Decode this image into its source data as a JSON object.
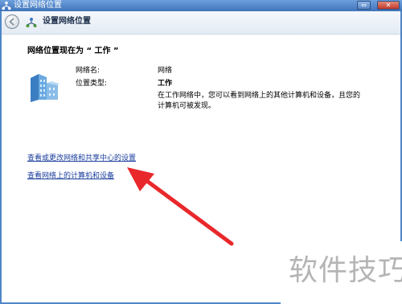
{
  "window": {
    "title": "设置网络位置",
    "icon": "network-icon",
    "controls": {
      "restore": "⇔",
      "close": "✕"
    }
  },
  "nav": {
    "back_icon": "back-arrow-icon",
    "icon": "network-icon",
    "title": "设置网络位置"
  },
  "main": {
    "heading": "网络位置现在为 “ 工作 ”",
    "network_icon": "work-network-icon",
    "fields": {
      "name_label": "网络名:",
      "name_value": "网络",
      "type_label": "位置类型:",
      "type_value": "工作"
    },
    "description": "在工作网络中，您可以看到网络上的其他计算机和设备，且您的计算机可被发现。",
    "links": {
      "change_settings": "查看或更改网络和共享中心的设置",
      "view_devices": "查看网络上的计算机和设备"
    }
  },
  "annotation": {
    "arrow_color": "#e8282b"
  },
  "watermark": {
    "text": "软件技巧"
  }
}
